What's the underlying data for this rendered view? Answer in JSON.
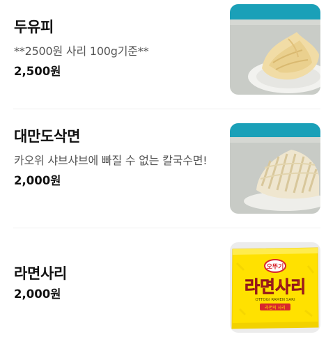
{
  "menu": {
    "items": [
      {
        "name": "두유피",
        "description": "**2500원 사리 100g기준**",
        "price": "2,500원",
        "image": "tofu-skin-photo"
      },
      {
        "name": "대만도삭면",
        "description": "카오위 샤브샤브에 빠질 수 없는 칼국수면!",
        "price": "2,000원",
        "image": "knife-cut-noodle-photo"
      },
      {
        "name": "라면사리",
        "description": "",
        "price": "2,000원",
        "image": "ramen-sari-package-photo",
        "package_text": {
          "brand": "오뚜기",
          "title": "라면사리",
          "subtitle": "OTTOGI RAMEN SARI",
          "badge": "라면의 사리"
        }
      }
    ]
  },
  "colors": {
    "photo_teal": "#1aa0b8",
    "package_yellow": "#ffe100",
    "package_red": "#d8262d"
  }
}
